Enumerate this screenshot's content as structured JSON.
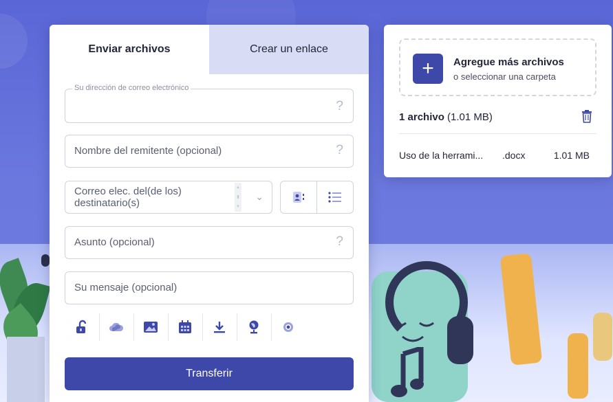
{
  "tabs": {
    "send_files": "Enviar archivos",
    "create_link": "Crear un enlace"
  },
  "form": {
    "email_label": "Su dirección de correo electrónico",
    "sender_placeholder": "Nombre del remitente (opcional)",
    "recipients_placeholder": "Correo elec. del(de los) destinatario(s)",
    "subject_placeholder": "Asunto (opcional)",
    "message_placeholder": "Su mensaje (opcional)",
    "help_glyph": "?",
    "transfer_button": "Transferir"
  },
  "toolbar_icons": [
    "lock-icon",
    "cloud-icon",
    "image-icon",
    "calendar-icon",
    "download-icon",
    "globe-icon",
    "eye-icon"
  ],
  "files_panel": {
    "add_title": "Agregue más archivos",
    "add_subtitle": "o seleccionar una carpeta",
    "count_bold": "1 archivo",
    "count_size": "(1.01 MB)",
    "file": {
      "name": "Uso de la herrami...",
      "ext": ".docx",
      "size": "1.01 MB"
    }
  },
  "colors": {
    "primary": "#3e48a8",
    "background": "#5a66d6",
    "inactive_tab": "#d8dcf4"
  }
}
